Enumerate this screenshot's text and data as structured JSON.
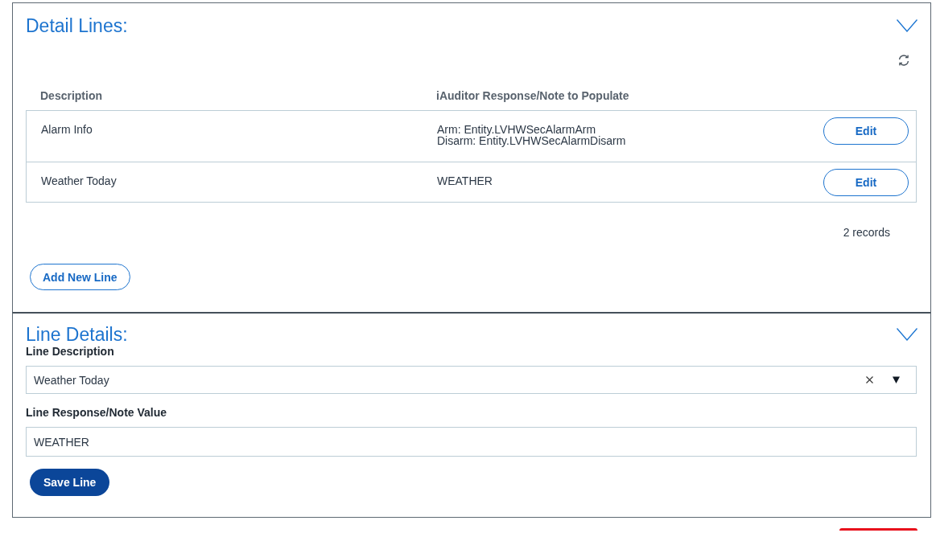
{
  "detail_lines": {
    "title": "Detail Lines:",
    "table": {
      "columns": [
        "Description",
        "iAuditor Response/Note to Populate"
      ],
      "rows": [
        {
          "description": "Alarm Info",
          "response_lines": [
            "Arm: Entity.LVHWSecAlarmArm",
            "Disarm: Entity.LVHWSecAlarmDisarm"
          ],
          "action": "Edit"
        },
        {
          "description": "Weather Today",
          "response_lines": [
            "WEATHER"
          ],
          "action": "Edit"
        }
      ]
    },
    "record_count": "2 records",
    "add_button": "Add New Line"
  },
  "line_details": {
    "title": "Line Details:",
    "fields": [
      {
        "kind": "select",
        "label": "Line Description",
        "value": "Weather Today"
      },
      {
        "kind": "text",
        "label": "Line Response/Note Value",
        "value": "WEATHER"
      }
    ],
    "save_button": "Save Line"
  }
}
